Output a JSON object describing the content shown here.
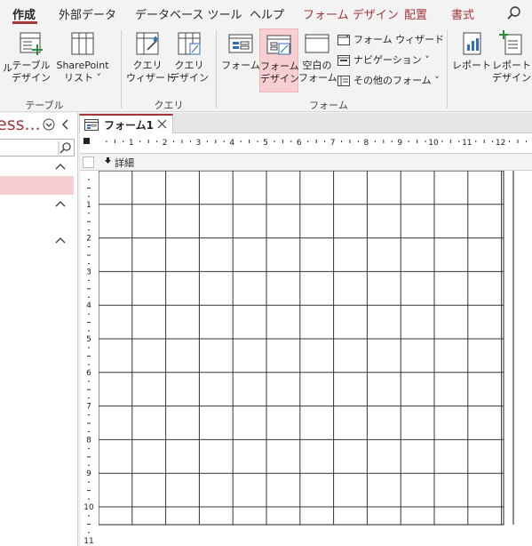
{
  "tabs": [
    {
      "label": "作成",
      "active": true
    },
    {
      "label": "外部データ"
    },
    {
      "label": "データベース ツール"
    },
    {
      "label": "ヘルプ"
    },
    {
      "label": "フォーム デザイン",
      "accent": true
    },
    {
      "label": "配置",
      "accent": true
    },
    {
      "label": "書式",
      "accent": true
    }
  ],
  "ribbon": {
    "tables": {
      "partial_label": "ル",
      "table_design": [
        "テーブル",
        "デザイン"
      ],
      "sharepoint": [
        "SharePoint",
        "リスト ˅"
      ],
      "group_label": "テーブル"
    },
    "queries": {
      "query_wizard": [
        "クエリ",
        "ウィザード"
      ],
      "query_design": [
        "クエリ",
        "デザイン"
      ],
      "group_label": "クエリ"
    },
    "forms": {
      "form": "フォーム",
      "form_design": [
        "フォーム",
        "デザイン"
      ],
      "blank_form": [
        "空白の",
        "フォーム"
      ],
      "form_wizard": "フォーム ウィザード",
      "navigation": "ナビゲーション ˅",
      "more_forms": "その他のフォーム ˅",
      "group_label": "フォーム"
    },
    "reports": {
      "report": "レポート",
      "report_design": [
        "レポート",
        "デザイン"
      ]
    }
  },
  "nav": {
    "title": "ess...",
    "search_placeholder": ""
  },
  "document": {
    "tab_label": "フォーム1",
    "section_label": "詳細",
    "hruler_labels": [
      "1",
      "2",
      "3",
      "4",
      "5",
      "6",
      "7",
      "8",
      "9",
      "10",
      "11",
      "12"
    ],
    "vruler_labels": [
      "1",
      "2",
      "3",
      "4",
      "5",
      "6",
      "7",
      "8",
      "9",
      "10",
      "11"
    ]
  },
  "colors": {
    "accent": "#a4373a",
    "selected": "#f7cfd2",
    "ribbon_bg": "#f3f3f3"
  }
}
